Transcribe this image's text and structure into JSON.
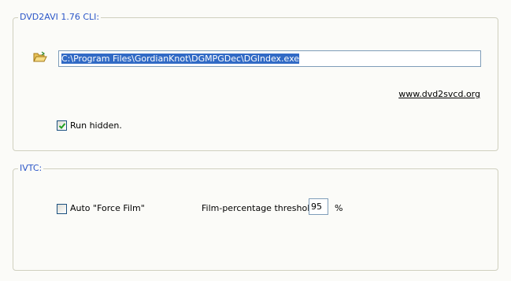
{
  "dvd2avi_group": {
    "title": "DVD2AVI 1.76 CLI:",
    "path_value": "C:\\Program Files\\GordianKnot\\DGMPGDec\\DGIndex.exe",
    "link_text": "www.dvd2svcd.org",
    "run_hidden_label": "Run hidden.",
    "run_hidden_checked": true
  },
  "ivtc_group": {
    "title": "IVTC:",
    "force_film_label": "Auto \"Force Film\"",
    "force_film_checked": false,
    "threshold_label": "Film-percentage threshold",
    "threshold_value": "95",
    "threshold_unit": "%"
  },
  "icons": {
    "browse": "folder-open-icon",
    "check": "checkmark-icon"
  },
  "colors": {
    "group_title": "#2b56c8",
    "selection": "#316ac5",
    "checkmark": "#21a121"
  }
}
